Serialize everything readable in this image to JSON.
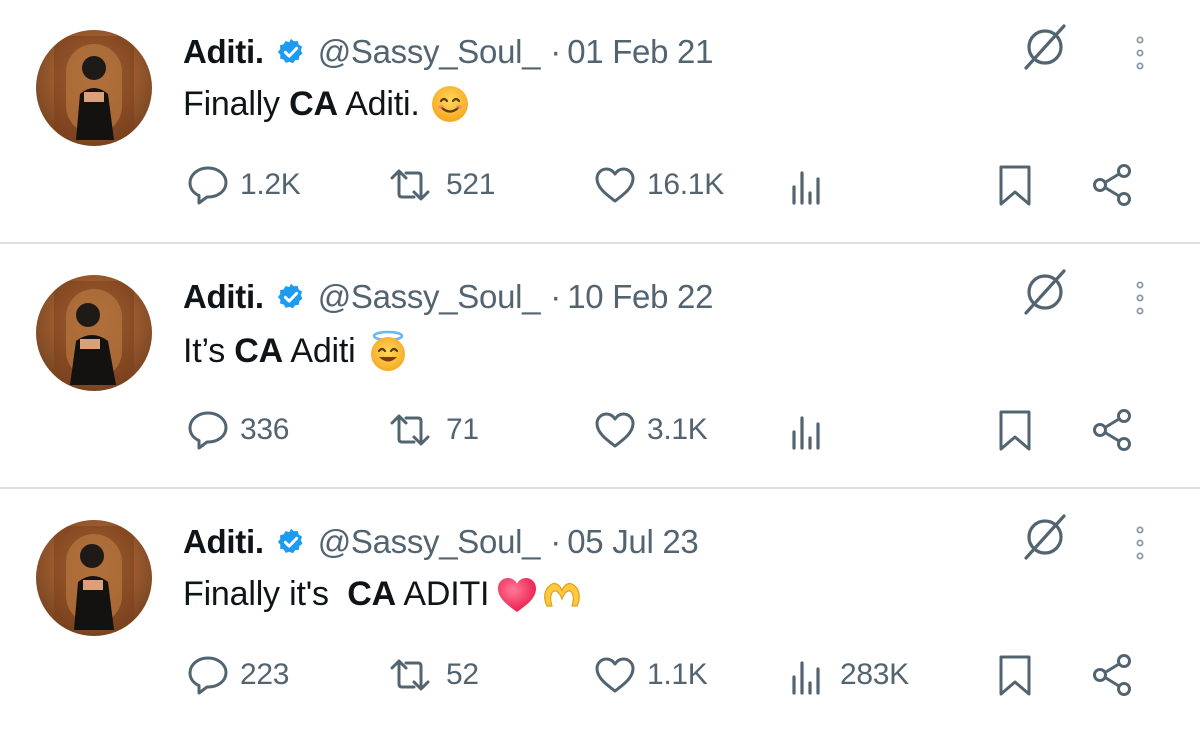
{
  "tweets": [
    {
      "name": "Aditi.",
      "handle": "@Sassy_Soul_",
      "separator": "·",
      "date": "01 Feb 21",
      "text_prefix": "Finally ",
      "text_bold": "CA",
      "text_suffix": " Aditi.",
      "emojis": [
        "smiling-face"
      ],
      "replies": "1.2K",
      "retweets": "521",
      "likes": "16.1K",
      "views": ""
    },
    {
      "name": "Aditi.",
      "handle": "@Sassy_Soul_",
      "separator": "·",
      "date": "10 Feb 22",
      "text_prefix": "It’s ",
      "text_bold": "CA",
      "text_suffix": " Aditi",
      "emojis": [
        "halo-face"
      ],
      "replies": "336",
      "retweets": "71",
      "likes": "3.1K",
      "views": ""
    },
    {
      "name": "Aditi.",
      "handle": "@Sassy_Soul_",
      "separator": "·",
      "date": "05 Jul 23",
      "text_prefix": "Finally it's  ",
      "text_bold": "CA",
      "text_suffix": " ADITI",
      "emojis": [
        "red-heart",
        "heart-hands"
      ],
      "replies": "223",
      "retweets": "52",
      "likes": "1.1K",
      "views": "283K"
    }
  ],
  "colors": {
    "text": "#0f1419",
    "secondary": "#536471",
    "verified": "#1d9bf0",
    "divider": "#dcdfe3"
  },
  "icons": [
    "verified-badge-icon",
    "grok-icon",
    "more-icon",
    "reply-icon",
    "retweet-icon",
    "like-icon",
    "views-icon",
    "bookmark-icon",
    "share-icon"
  ]
}
